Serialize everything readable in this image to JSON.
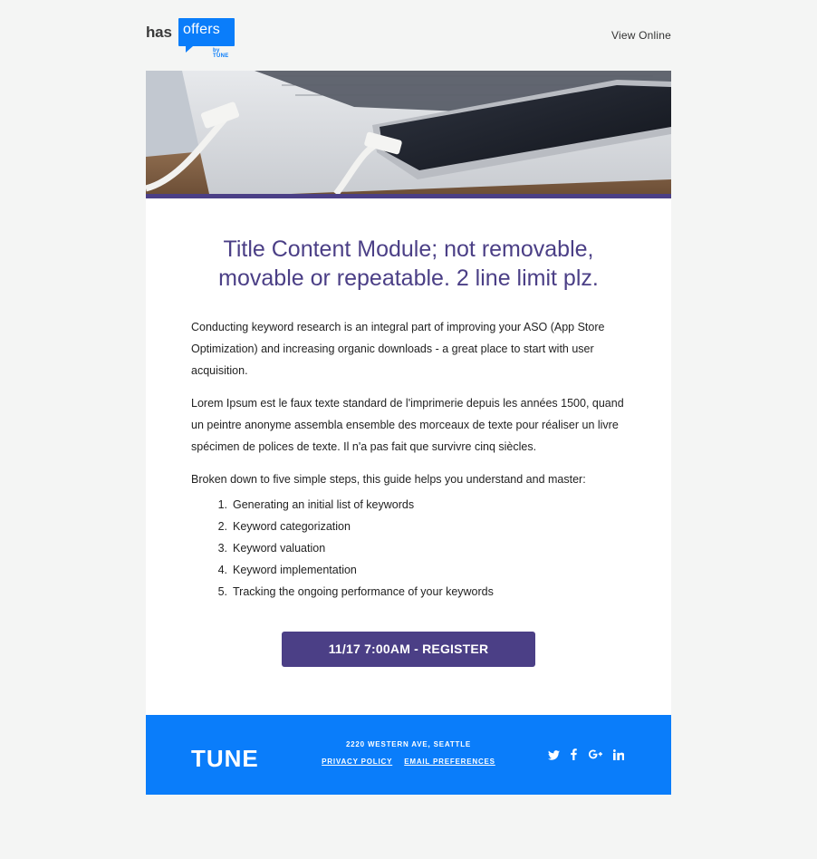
{
  "header": {
    "logo_has": "has",
    "logo_offers": "offers",
    "logo_by": "by TUNE",
    "view_online": "View Online"
  },
  "content": {
    "title": "Title Content Module; not removable, movable or repeatable. 2 line limit plz.",
    "paragraphs": [
      "Conducting keyword research is an integral part of improving your ASO (App Store Optimization) and increasing organic downloads - a great place to start with user acquisition.",
      "Lorem Ipsum est le faux texte standard de l'imprimerie depuis les années 1500, quand un peintre anonyme assembla ensemble des morceaux de texte pour réaliser un livre spécimen de polices de texte. Il n'a pas fait que survivre cinq siècles.",
      "Broken down to five simple steps, this guide helps you understand and master:"
    ],
    "steps": [
      {
        "num": "1.",
        "text": "Generating an initial list of keywords"
      },
      {
        "num": "2.",
        "text": "Keyword categorization"
      },
      {
        "num": "3.",
        "text": "Keyword valuation"
      },
      {
        "num": "4.",
        "text": "Keyword implementation"
      },
      {
        "num": "5.",
        "text": "Tracking the ongoing performance of your keywords"
      }
    ],
    "cta_label": "11/17 7:00AM - REGISTER"
  },
  "footer": {
    "logo": "TUNE",
    "address": "2220 WESTERN AVE, SEATTLE",
    "privacy_policy": "PRIVACY POLICY",
    "email_preferences": "EMAIL PREFERENCES",
    "social": {
      "twitter": "twitter-icon",
      "facebook": "facebook-icon",
      "google_plus": "google-plus-icon",
      "linkedin": "linkedin-icon"
    }
  },
  "colors": {
    "brand_blue": "#0a7dfa",
    "accent_purple": "#4b3f86",
    "page_bg": "#f4f5f4"
  }
}
